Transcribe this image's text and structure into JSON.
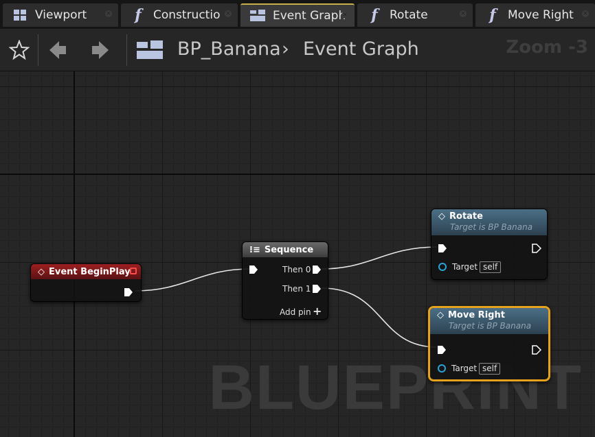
{
  "tabs": [
    {
      "label": "Viewport",
      "icon": "viewport-icon"
    },
    {
      "label": "Constructio",
      "icon": "function-icon"
    },
    {
      "label": "Event Graph",
      "icon": "event-graph-icon"
    },
    {
      "label": "Rotate",
      "icon": "function-icon"
    },
    {
      "label": "Move Right",
      "icon": "function-icon"
    }
  ],
  "function_glyph": "f",
  "toolbar": {
    "breadcrumb_blueprint": "BP_Banana",
    "breadcrumb_graph": "Event Graph",
    "zoom": "Zoom -3",
    "icons": [
      "star-icon",
      "back-arrow-icon",
      "forward-arrow-icon",
      "event-graph-icon"
    ]
  },
  "graph": {
    "watermark": "BLUEPRINT",
    "nodes": {
      "event_begin_play": {
        "title": "Event BeginPlay",
        "header_color": "#9d1f21"
      },
      "sequence": {
        "title": "Sequence",
        "pins": [
          "Then 0",
          "Then 1"
        ],
        "add_pin": "Add pin"
      },
      "rotate": {
        "title": "Rotate",
        "subtitle": "Target is BP Banana",
        "target_label": "Target",
        "target_value": "self"
      },
      "move_right": {
        "title": "Move Right",
        "subtitle": "Target is BP Banana",
        "target_label": "Target",
        "target_value": "self",
        "selected": true,
        "highlight_color": "#e6a11d"
      }
    }
  }
}
